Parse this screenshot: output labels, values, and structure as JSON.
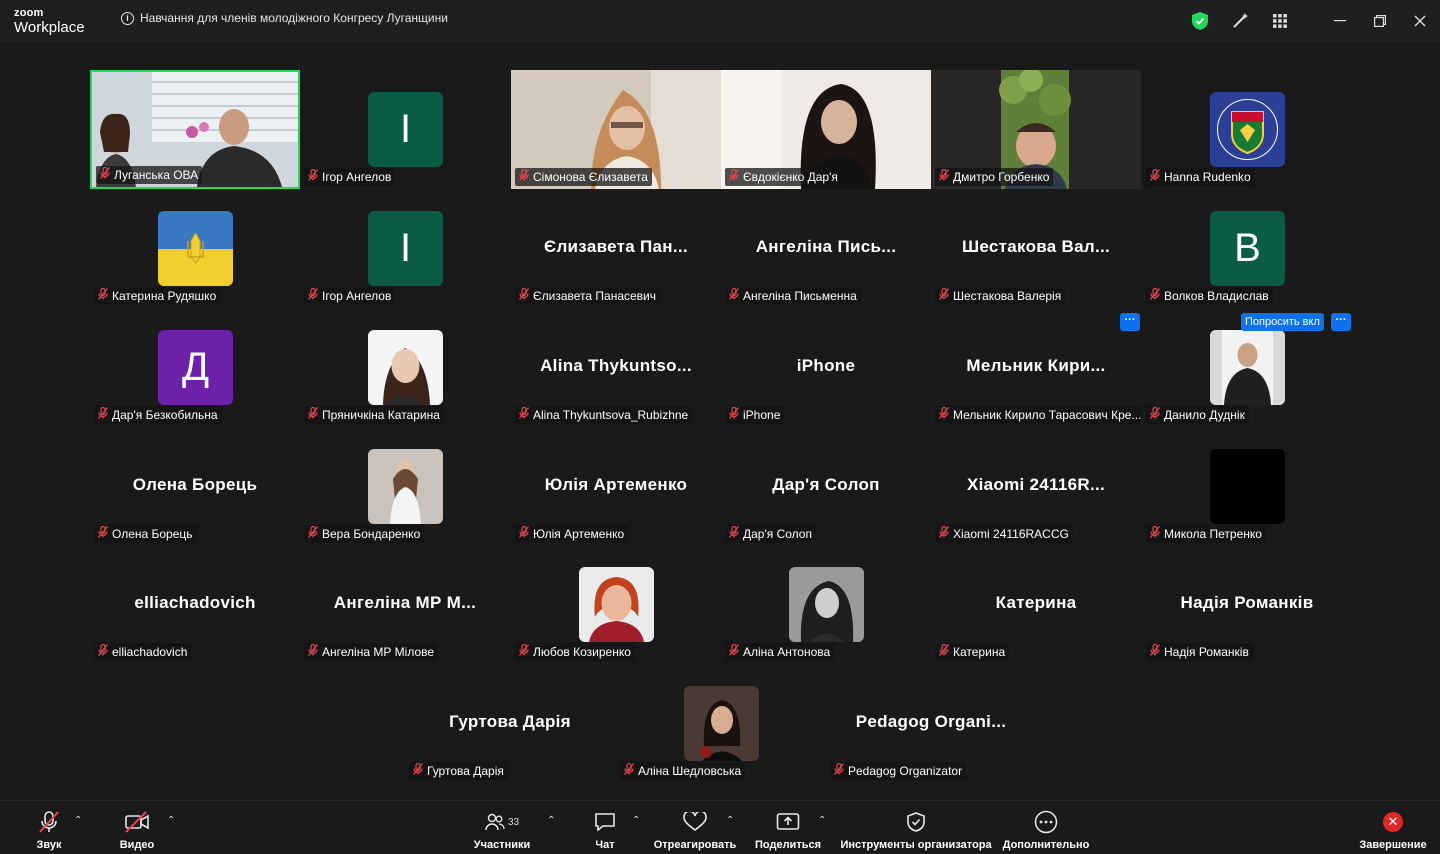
{
  "app": {
    "brand_top": "zoom",
    "brand_bottom": "Workplace"
  },
  "meeting": {
    "title": "Навчання для членів молодіжного Конгресу Луганщини"
  },
  "colors": {
    "accent_green": "#23d959",
    "mute_red": "#e5484d",
    "hover_blue": "#0e72ed",
    "end_red": "#e02828"
  },
  "tiles": [
    {
      "label": "Луганська ОВА",
      "kind": "video",
      "selected": true
    },
    {
      "label": "Ігор Ангелов",
      "kind": "avatar",
      "initial": "І",
      "avatar_color": "#0a5c47"
    },
    {
      "label": "Сімонова Єлизавета",
      "kind": "video"
    },
    {
      "label": "Євдокієнко Дар'я",
      "kind": "video"
    },
    {
      "label": "Дмитро Горбенко",
      "kind": "video"
    },
    {
      "label": "Hanna Rudenko",
      "kind": "image",
      "image": "coat-of-arms"
    },
    {
      "label": "Катерина Рудяшко",
      "kind": "image",
      "image": "ukraine-flag"
    },
    {
      "label": "Ігор Ангелов",
      "kind": "avatar",
      "initial": "І",
      "avatar_color": "#0a5c47"
    },
    {
      "label": "Єлизавета Панасевич",
      "kind": "name",
      "bigname": "Єлизавета Пан..."
    },
    {
      "label": "Ангеліна Письменна",
      "kind": "name",
      "bigname": "Ангеліна Пись..."
    },
    {
      "label": "Шестакова Валерія",
      "kind": "name",
      "bigname": "Шестакова Вал..."
    },
    {
      "label": "Волков Владислав",
      "kind": "avatar",
      "initial": "В",
      "avatar_color": "#0a5c47"
    },
    {
      "label": "Дар'я Безкобильна",
      "kind": "avatar",
      "initial": "Д",
      "avatar_color": "#6b21a8"
    },
    {
      "label": "Пряничкіна Катарина",
      "kind": "image",
      "image": "portrait-woman"
    },
    {
      "label": "Alina Thykuntsova_Rubizhne",
      "kind": "name",
      "bigname": "Alina Thykuntso..."
    },
    {
      "label": "iPhone",
      "kind": "name",
      "bigname": "iPhone"
    },
    {
      "label": "Мельник Кирило Тарасович Кре...",
      "kind": "name",
      "bigname": "Мельник Кири..."
    },
    {
      "label": "Данило Дуднік",
      "kind": "image",
      "image": "portrait-man"
    },
    {
      "label": "Олена Борець",
      "kind": "name",
      "bigname": "Олена Борець"
    },
    {
      "label": "Вера Бондаренко",
      "kind": "image",
      "image": "portrait-woman-light"
    },
    {
      "label": "Юлія Артеменко",
      "kind": "name",
      "bigname": "Юлія Артеменко"
    },
    {
      "label": "Дар'я Солоп",
      "kind": "name",
      "bigname": "Дар'я Солоп"
    },
    {
      "label": "Xiaomi 24116RACCG",
      "kind": "name",
      "bigname": "Xiaomi 24116R..."
    },
    {
      "label": "Микола Петренко",
      "kind": "avatar",
      "initial": "",
      "avatar_color": "#000000"
    },
    {
      "label": "elliachadovich",
      "kind": "name",
      "bigname": "elliachadovich"
    },
    {
      "label": "Ангеліна МР Мілове",
      "kind": "name",
      "bigname": "Ангеліна МР М..."
    },
    {
      "label": "Любов Козиренко",
      "kind": "image",
      "image": "portrait-redhead"
    },
    {
      "label": "Аліна Антонова",
      "kind": "image",
      "image": "portrait-bw"
    },
    {
      "label": "Катерина",
      "kind": "name",
      "bigname": "Катерина"
    },
    {
      "label": "Надія Романків",
      "kind": "name",
      "bigname": "Надія Романків"
    },
    {
      "label": "Гуртова Дарія",
      "kind": "name",
      "bigname": "Гуртова Дарія"
    },
    {
      "label": "Аліна Шедловська",
      "kind": "image",
      "image": "portrait-dark"
    },
    {
      "label": "Pedagog Organizator",
      "kind": "name",
      "bigname": "Pedagog Organi..."
    }
  ],
  "hover": {
    "ask_label": "Попросить вкл",
    "more_label": "···"
  },
  "toolbar": {
    "audio_label": "Звук",
    "video_label": "Видео",
    "participants_label": "Участники",
    "participants_count": "33",
    "chat_label": "Чат",
    "react_label": "Отреагировать",
    "share_label": "Поделиться",
    "host_tools_label": "Инструменты организатора",
    "more_label": "Дополнительно",
    "end_label": "Завершение"
  }
}
